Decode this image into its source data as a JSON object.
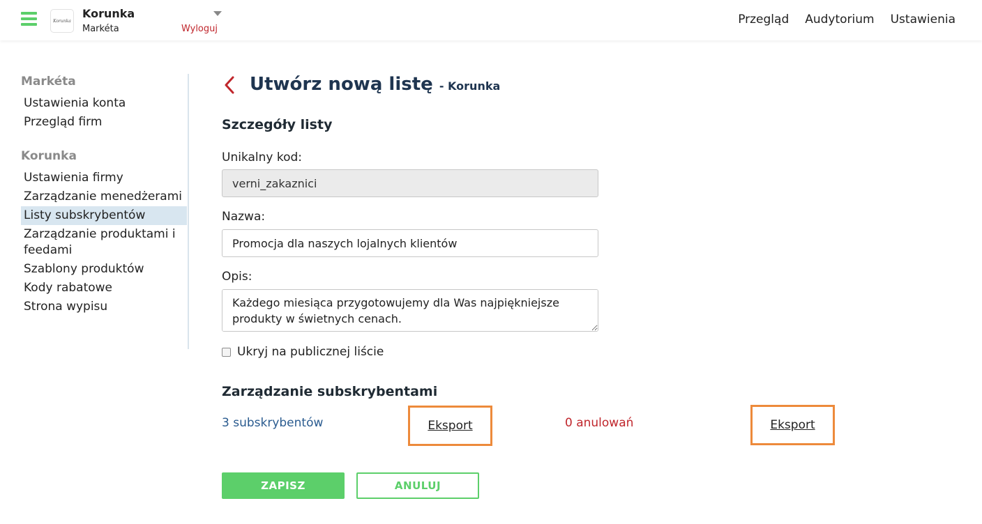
{
  "header": {
    "brand_name": "Korunka",
    "user_name": "Markéta",
    "logo_text": "Korunka",
    "logout_label": "Wyloguj",
    "nav": [
      "Przegląd",
      "Audytorium",
      "Ustawienia"
    ]
  },
  "sidebar": {
    "user_heading": "Markéta",
    "user_items": [
      "Ustawienia konta",
      "Przegląd firm"
    ],
    "company_heading": "Korunka",
    "company_items": [
      "Ustawienia firmy",
      "Zarządzanie menedżerami",
      "Listy subskrybentów",
      "Zarządzanie produktami i feedami",
      "Szablony produktów",
      "Kody rabatowe",
      "Strona wypisu"
    ],
    "active_item": "Listy subskrybentów"
  },
  "main": {
    "title": "Utwórz nową listę",
    "title_suffix": "- Korunka",
    "details_heading": "Szczegóły listy",
    "code_label": "Unikalny kod:",
    "code_value": "verni_zakaznici",
    "name_label": "Nazwa:",
    "name_value": "Promocja dla naszych lojalnych klientów",
    "desc_label": "Opis:",
    "desc_value": "Każdego miesiąca przygotowujemy dla Was najpiękniejsze produkty w świetnych cenach.",
    "hide_label": "Ukryj na publicznej liście",
    "hide_checked": false,
    "subscribers_heading": "Zarządzanie subskrybentami",
    "subscribers_count": "3 subskrybentów",
    "export_label": "Eksport",
    "cancellations_count": "0 anulowań",
    "export2_label": "Eksport",
    "save_label": "ZAPISZ",
    "cancel_label": "ANULUJ"
  },
  "colors": {
    "accent_green": "#5ccf6a",
    "title_blue": "#1f3550",
    "link_blue": "#2a5b8f",
    "danger_red": "#c0262c",
    "highlight_orange": "#ed8a3b",
    "active_bg": "#d8e6f0"
  }
}
